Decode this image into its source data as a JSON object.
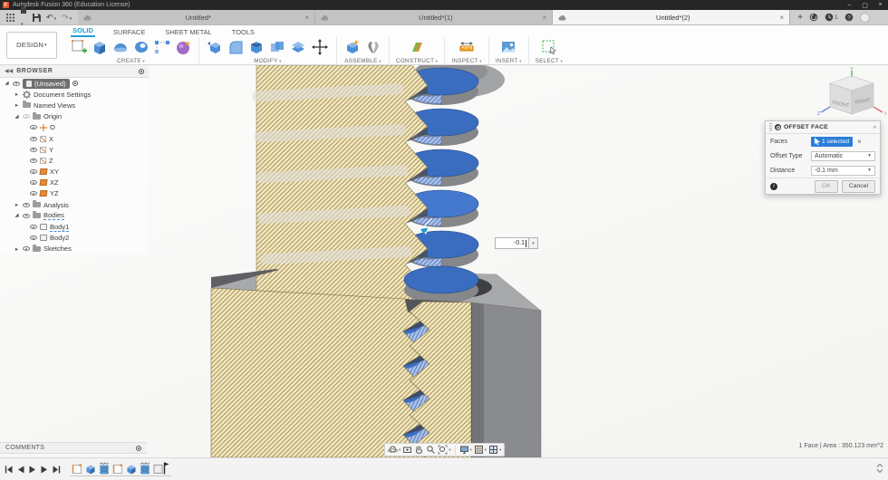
{
  "window": {
    "title": "Autodesk Fusion 360 (Education License)"
  },
  "tabbar": {
    "tabs": [
      {
        "label": "Untitled*"
      },
      {
        "label": "Untitled*(1)"
      },
      {
        "label": "Untitled*(2)"
      }
    ],
    "active_tab_index": 2,
    "job_badge_count": "1"
  },
  "toolbar": {
    "workspace_label": "DESIGN",
    "ribbon_tabs": [
      {
        "label": "SOLID"
      },
      {
        "label": "SURFACE"
      },
      {
        "label": "SHEET METAL"
      },
      {
        "label": "TOOLS"
      }
    ],
    "active_ribbon_tab": "SOLID",
    "groups": [
      {
        "label": "CREATE"
      },
      {
        "label": "MODIFY"
      },
      {
        "label": "ASSEMBLE"
      },
      {
        "label": "CONSTRUCT"
      },
      {
        "label": "INSPECT"
      },
      {
        "label": "INSERT"
      },
      {
        "label": "SELECT"
      }
    ]
  },
  "browser": {
    "title": "BROWSER",
    "rows": [
      {
        "label": "(Unsaved)"
      },
      {
        "label": "Document Settings"
      },
      {
        "label": "Named Views"
      },
      {
        "label": "Origin"
      },
      {
        "label": "O"
      },
      {
        "label": "X"
      },
      {
        "label": "Y"
      },
      {
        "label": "Z"
      },
      {
        "label": "XY"
      },
      {
        "label": "XZ"
      },
      {
        "label": "YZ"
      },
      {
        "label": "Analysis"
      },
      {
        "label": "Bodies"
      },
      {
        "label": "Body1"
      },
      {
        "label": "Body2"
      },
      {
        "label": "Sketches"
      }
    ]
  },
  "dialog": {
    "title": "OFFSET FACE",
    "faces_label": "Faces",
    "faces_value": "1 selected",
    "offset_type_label": "Offset Type",
    "offset_type_value": "Automatic",
    "distance_label": "Distance",
    "distance_value": "-0.1 mm",
    "ok_label": "OK",
    "cancel_label": "Cancel"
  },
  "viewcube": {
    "front": "FRONT",
    "right": "RIGHT",
    "axis_x": "X",
    "axis_y": "Y",
    "axis_z": "Z"
  },
  "canvas": {
    "floating_input_value": "-0.1",
    "status_text": "1 Face | Area : 350.123 mm^2"
  },
  "comments": {
    "title": "COMMENTS"
  },
  "colors": {
    "accent_blue": "#1fa0d8",
    "chip_blue": "#2a7fd8",
    "selection_blue": "#3a6dc0",
    "section_tan": "#f3e5bd",
    "hatch_line": "#98894f"
  }
}
